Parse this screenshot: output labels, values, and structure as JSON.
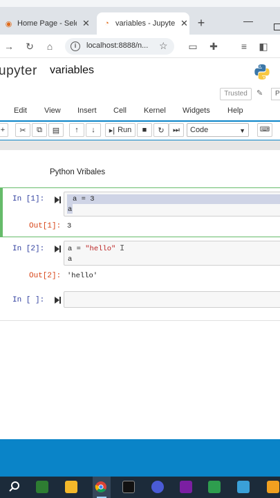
{
  "browser": {
    "tabs": [
      {
        "label": "Home Page - Select",
        "active": false
      },
      {
        "label": "variables - Jupyter",
        "active": true
      }
    ],
    "url": "localhost:8888/n..."
  },
  "jupyter": {
    "logo": "upyter",
    "notebook_title": "variables",
    "trusted": "Trusted",
    "kernel_badge": "P",
    "menu": [
      "Edit",
      "View",
      "Insert",
      "Cell",
      "Kernel",
      "Widgets",
      "Help"
    ],
    "toolbar": {
      "run_label": "Run",
      "cell_type": "Code"
    }
  },
  "notebook": {
    "markdown": "Python Vribales",
    "cells": [
      {
        "prompt": "In [1]:",
        "lines": [
          "a = 3",
          "a"
        ],
        "out_prompt": "Out[1]:",
        "output": "3"
      },
      {
        "prompt": "In [2]:",
        "lines": [
          "a = \"hello\"",
          "a"
        ],
        "out_prompt": "Out[2]:",
        "output": "'hello'"
      },
      {
        "prompt": "In [ ]:",
        "lines": [],
        "out_prompt": "",
        "output": ""
      }
    ]
  },
  "icons": {
    "tab_favicon_1": "web-icon",
    "tab_favicon_2": "jupyter-icon",
    "brand_color": "#0a84c8",
    "selected_cell_color": "#66bb6a"
  }
}
